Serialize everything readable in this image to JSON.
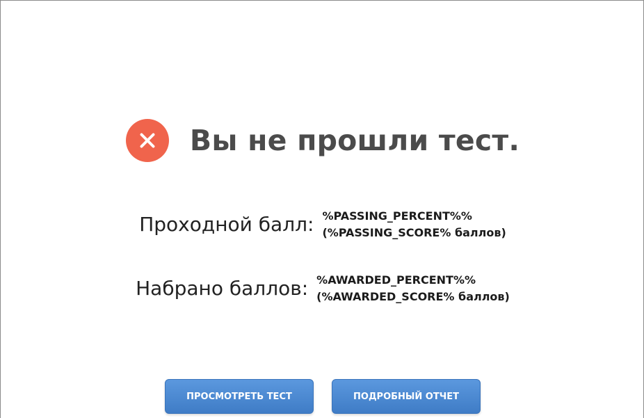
{
  "result": {
    "icon": "fail-x-icon",
    "icon_color": "#f0644c",
    "title": "Вы не прошли тест."
  },
  "passing": {
    "label": "Проходной балл:",
    "percent": "%PASSING_PERCENT%%",
    "score": "(%PASSING_SCORE% баллов)"
  },
  "awarded": {
    "label": "Набрано баллов:",
    "percent": "%AWARDED_PERCENT%%",
    "score": "(%AWARDED_SCORE% баллов)"
  },
  "actions": {
    "review_label": "ПРОСМОТРЕТЬ ТЕСТ",
    "report_label": "ПОДРОБНЫЙ ОТЧЕТ",
    "button_color": "#4a87d0"
  }
}
